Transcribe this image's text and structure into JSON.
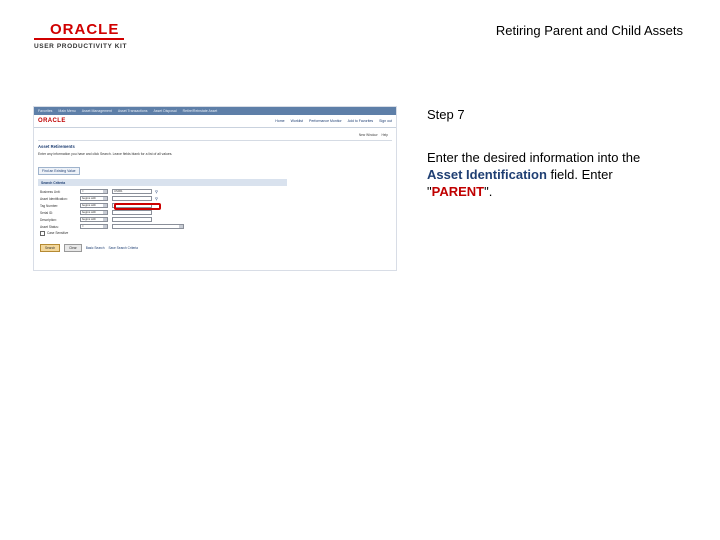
{
  "header": {
    "logo_brand": "ORACLE",
    "logo_product": "USER PRODUCTIVITY KIT",
    "doc_title": "Retiring Parent and Child Assets"
  },
  "screenshot": {
    "nav": [
      "Favorites",
      "Main Menu",
      "Asset Management",
      "Asset Transactions",
      "Asset Disposal",
      "Retire/Reinstate Asset"
    ],
    "logo": "ORACLE",
    "header_links": [
      "Home",
      "Worklist",
      "Performance Monitor",
      "Add to Favorites",
      "Sign out"
    ],
    "tools": [
      "New Window",
      "Help"
    ],
    "page_title": "Asset Retirements",
    "instructions": "Enter any information you have and click Search. Leave fields blank for a list of all values.",
    "tab": "Find an Existing Value",
    "criteria_header": "Search Criteria",
    "rows": [
      {
        "label": "Business Unit:",
        "op": "=",
        "value": "US001"
      },
      {
        "label": "Asset Identification:",
        "op": "begins with",
        "value": ""
      },
      {
        "label": "Tag Number:",
        "op": "begins with",
        "value": ""
      },
      {
        "label": "Serial ID:",
        "op": "begins with",
        "value": ""
      },
      {
        "label": "Description:",
        "op": "begins with",
        "value": ""
      },
      {
        "label": "Asset Status:",
        "op": "=",
        "value": ""
      }
    ],
    "case_sensitive": "Case Sensitive",
    "buttons": {
      "search": "Search",
      "clear": "Clear",
      "basic_search": "Basic Search",
      "save_criteria": "Save Search Criteria"
    }
  },
  "panel": {
    "step": "Step 7",
    "text_1": "Enter the desired information into the ",
    "field_name": "Asset Identification",
    "text_2": " field. Enter \"",
    "value": "PARENT",
    "text_3": "\"."
  }
}
